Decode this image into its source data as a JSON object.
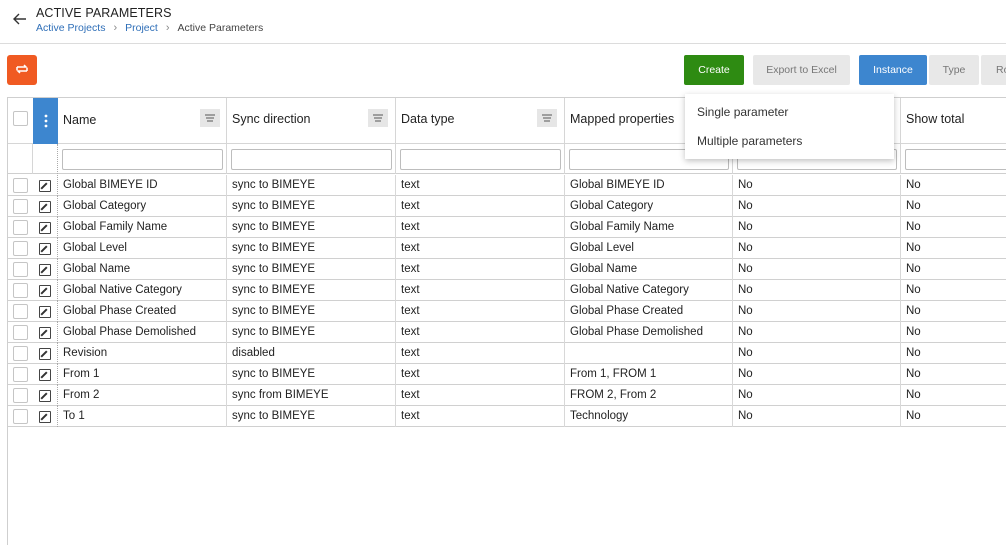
{
  "header": {
    "title": "ACTIVE PARAMETERS",
    "breadcrumbs": [
      "Active Projects",
      "Project"
    ],
    "current": "Active Parameters"
  },
  "toolbar": {
    "create_label": "Create",
    "export_label": "Export to Excel",
    "instance_label": "Instance",
    "type_label": "Type",
    "ro_label": "Ro",
    "accent_orange": "#f05a22",
    "accent_green": "#2e8b12",
    "accent_blue": "#3d86cf"
  },
  "dropdown": {
    "items": [
      "Single parameter",
      "Multiple parameters"
    ]
  },
  "grid": {
    "columns": [
      "Name",
      "Sync direction",
      "Data type",
      "Mapped properties",
      "",
      "Show total"
    ],
    "rows": [
      {
        "name": "Global BIMEYE ID",
        "sync": "sync to BIMEYE",
        "type": "text",
        "mapped": "Global BIMEYE ID",
        "c5": "No",
        "total": "No"
      },
      {
        "name": "Global Category",
        "sync": "sync to BIMEYE",
        "type": "text",
        "mapped": "Global Category",
        "c5": "No",
        "total": "No"
      },
      {
        "name": "Global Family Name",
        "sync": "sync to BIMEYE",
        "type": "text",
        "mapped": "Global Family Name",
        "c5": "No",
        "total": "No"
      },
      {
        "name": "Global Level",
        "sync": "sync to BIMEYE",
        "type": "text",
        "mapped": "Global Level",
        "c5": "No",
        "total": "No"
      },
      {
        "name": "Global Name",
        "sync": "sync to BIMEYE",
        "type": "text",
        "mapped": "Global Name",
        "c5": "No",
        "total": "No"
      },
      {
        "name": "Global Native Category",
        "sync": "sync to BIMEYE",
        "type": "text",
        "mapped": "Global Native Category",
        "c5": "No",
        "total": "No"
      },
      {
        "name": "Global Phase Created",
        "sync": "sync to BIMEYE",
        "type": "text",
        "mapped": "Global Phase Created",
        "c5": "No",
        "total": "No"
      },
      {
        "name": "Global Phase Demolished",
        "sync": "sync to BIMEYE",
        "type": "text",
        "mapped": "Global Phase Demolished",
        "c5": "No",
        "total": "No"
      },
      {
        "name": "Revision",
        "sync": "disabled",
        "type": "text",
        "mapped": "",
        "c5": "No",
        "total": "No"
      },
      {
        "name": "From 1",
        "sync": "sync to BIMEYE",
        "type": "text",
        "mapped": "From 1, FROM 1",
        "c5": "No",
        "total": "No"
      },
      {
        "name": "From 2",
        "sync": "sync from BIMEYE",
        "type": "text",
        "mapped": "FROM 2, From 2",
        "c5": "No",
        "total": "No"
      },
      {
        "name": "To 1",
        "sync": "sync to BIMEYE",
        "type": "text",
        "mapped": "Technology",
        "c5": "No",
        "total": "No"
      }
    ]
  }
}
